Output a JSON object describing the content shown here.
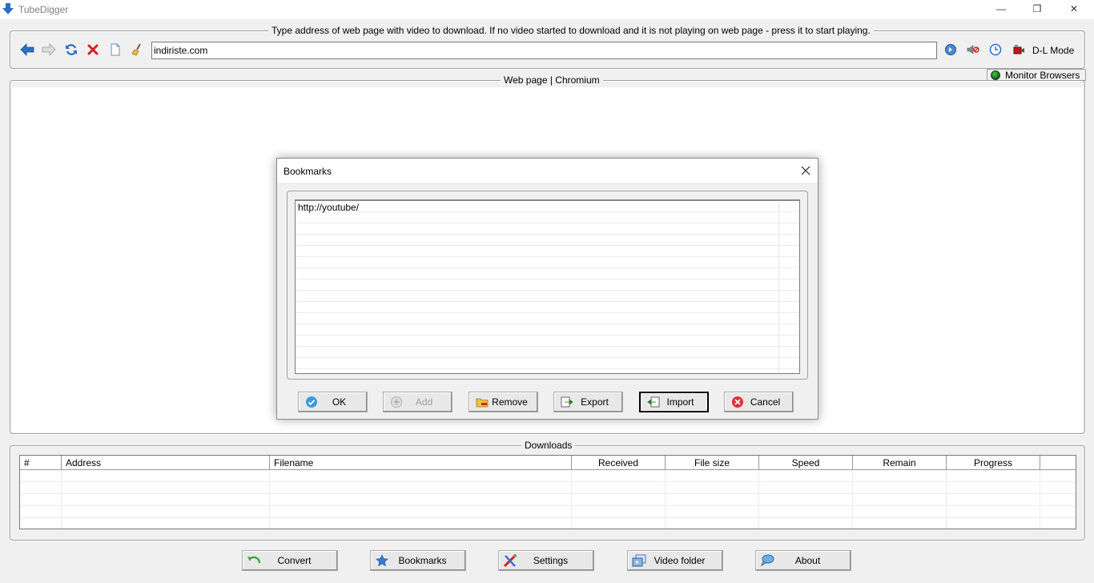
{
  "window": {
    "title": "TubeDigger",
    "minimize_glyph": "—",
    "restore_glyph": "❐",
    "close_glyph": "✕"
  },
  "address_bar": {
    "legend": "Type address of web page with video to download. If no video started to download and it is not playing on web page - press it to start playing.",
    "url_value": "indiriste.com",
    "dl_mode_label": "D-L Mode"
  },
  "web_panel": {
    "legend": "Web page | Chromium",
    "monitor_label": "Monitor Browsers"
  },
  "bookmarks_dialog": {
    "title": "Bookmarks",
    "items": [
      "http://youtube/"
    ],
    "buttons": {
      "ok": "OK",
      "add": "Add",
      "remove": "Remove",
      "export": "Export",
      "import": "Import",
      "cancel": "Cancel"
    }
  },
  "downloads": {
    "legend": "Downloads",
    "columns": [
      "#",
      "Address",
      "Filename",
      "Received",
      "File size",
      "Speed",
      "Remain",
      "Progress"
    ]
  },
  "bottom_buttons": {
    "convert": "Convert",
    "bookmarks": "Bookmarks",
    "settings": "Settings",
    "video_folder": "Video folder",
    "about": "About"
  },
  "colors": {
    "accent_blue": "#2b6fc2",
    "stop_red": "#d62020",
    "monitor_led": "#1f8a1f"
  }
}
